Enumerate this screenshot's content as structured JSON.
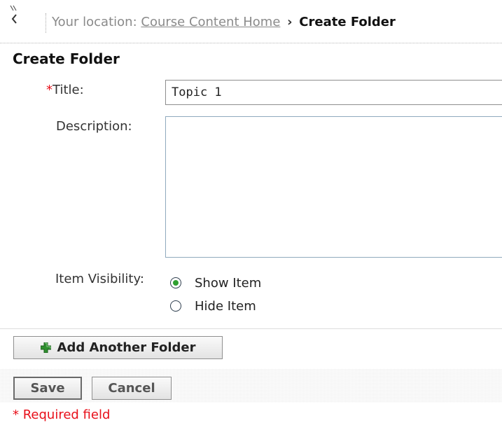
{
  "breadcrumb": {
    "prefix": "Your location:",
    "link": "Course Content Home",
    "separator": "›",
    "current": "Create Folder"
  },
  "page": {
    "title": "Create Folder"
  },
  "form": {
    "required_marker": "*",
    "title_label": "Title:",
    "title_value": "Topic 1",
    "description_label": "Description:",
    "description_value": "",
    "visibility_label": "Item Visibility:",
    "visibility_options": [
      {
        "label": "Show Item",
        "selected": true
      },
      {
        "label": "Hide Item",
        "selected": false
      }
    ]
  },
  "actions": {
    "add_folder_label": "Add Another Folder",
    "save_label": "Save",
    "cancel_label": "Cancel"
  },
  "footer": {
    "required_note": "* Required field"
  },
  "colors": {
    "required": "#e8101a",
    "radio_selected": "#30a030",
    "add_icon": "#2f8f2f"
  },
  "icons": {
    "back": "back-arrow-icon",
    "add": "plus-icon"
  }
}
